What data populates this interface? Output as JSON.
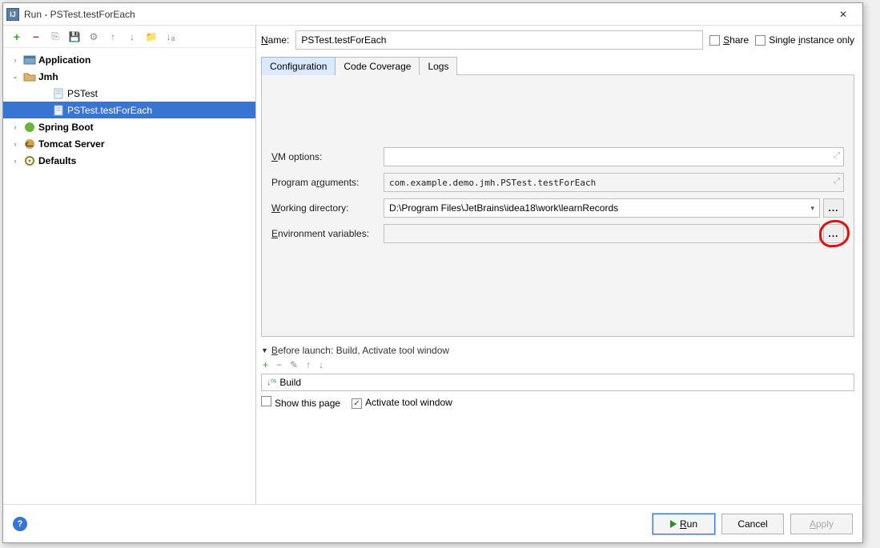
{
  "window": {
    "title": "Run - PSTest.testForEach"
  },
  "tree": {
    "items": [
      {
        "label": "Application",
        "level": 0,
        "expandable": true,
        "expanded": false,
        "icon": "app",
        "bold": true
      },
      {
        "label": "Jmh",
        "level": 0,
        "expandable": true,
        "expanded": true,
        "icon": "folder",
        "bold": true
      },
      {
        "label": "PSTest",
        "level": 1,
        "expandable": false,
        "icon": "file",
        "bold": false
      },
      {
        "label": "PSTest.testForEach",
        "level": 1,
        "expandable": false,
        "icon": "file",
        "bold": false,
        "selected": true
      },
      {
        "label": "Spring Boot",
        "level": 0,
        "expandable": true,
        "expanded": false,
        "icon": "spring",
        "bold": true
      },
      {
        "label": "Tomcat Server",
        "level": 0,
        "expandable": true,
        "expanded": false,
        "icon": "tomcat",
        "bold": true
      },
      {
        "label": "Defaults",
        "level": 0,
        "expandable": true,
        "expanded": false,
        "icon": "gear",
        "bold": true
      }
    ]
  },
  "name": {
    "label_pre": "N",
    "label_rest": "ame:",
    "value": "PSTest.testForEach"
  },
  "options": {
    "share_pre": "S",
    "share_rest": "hare",
    "single_rest": "Single ",
    "single_u": "i",
    "single_tail": "nstance only"
  },
  "tabs": {
    "configuration": "Configuration",
    "code_coverage": "Code Coverage",
    "logs": "Logs"
  },
  "fields": {
    "vm_label_pre": "V",
    "vm_label_rest": "M options:",
    "vm_value": "",
    "args_label_pre": "Program a",
    "args_u": "r",
    "args_label_rest": "guments:",
    "args_value": "com.example.demo.jmh.PSTest.testForEach",
    "wd_u": "W",
    "wd_label_rest": "orking directory:",
    "wd_value": "D:\\Program Files\\JetBrains\\idea18\\work\\learnRecords",
    "env_u": "E",
    "env_label_rest": "nvironment variables:",
    "env_value": ""
  },
  "before": {
    "header_pre": "B",
    "header_rest": "efore launch: Build, Activate tool window",
    "build": "Build",
    "show_this_page": "Show this page",
    "activate_tool_window": "Activate tool window",
    "show_checked": false,
    "activate_checked": true
  },
  "footer": {
    "run_pre": "R",
    "run_rest": "un",
    "cancel": "Cancel",
    "apply_pre": "A",
    "apply_rest": "pply"
  }
}
